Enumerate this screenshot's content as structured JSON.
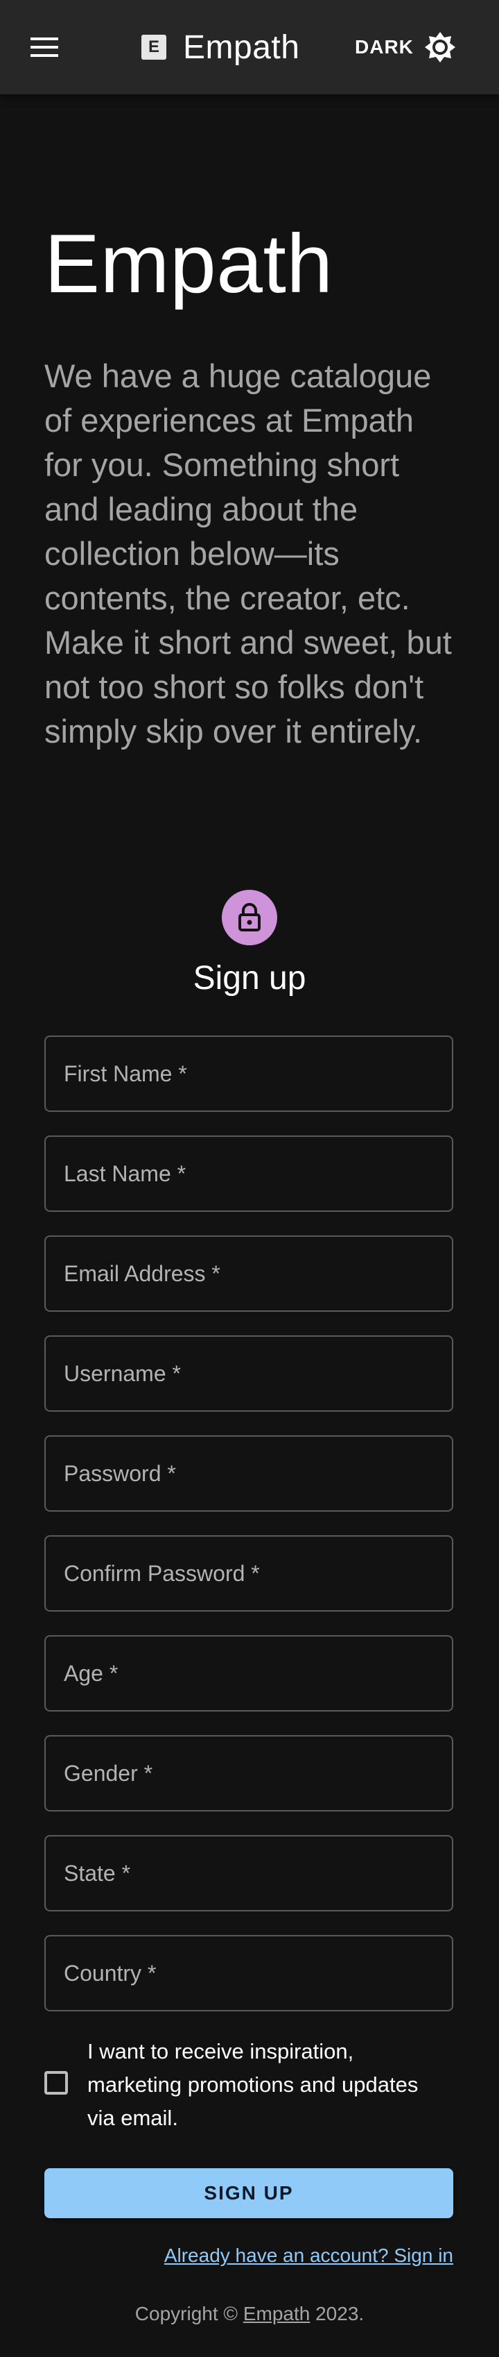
{
  "appbar": {
    "menu_icon": "hamburger-menu-icon",
    "logo_letter": "E",
    "title": "Empath",
    "theme_label": "DARK",
    "theme_icon": "brightness-icon"
  },
  "hero": {
    "title": "Empath",
    "description": "We have a huge catalogue of experiences at Empath for you. Something short and leading about the collection below—its contents, the creator, etc. Make it short and sweet, but not too short so folks don't simply skip over it entirely."
  },
  "signup": {
    "avatar_icon": "lock-icon",
    "title": "Sign up",
    "fields": [
      {
        "label": "First Name *"
      },
      {
        "label": "Last Name *"
      },
      {
        "label": "Email Address *"
      },
      {
        "label": "Username *"
      },
      {
        "label": "Password *"
      },
      {
        "label": "Confirm Password *"
      },
      {
        "label": "Age *"
      },
      {
        "label": "Gender *"
      },
      {
        "label": "State *"
      },
      {
        "label": "Country *"
      }
    ],
    "marketing_checkbox_label": "I want to receive inspiration, marketing promotions and updates via email.",
    "marketing_checked": false,
    "submit_label": "SIGN UP",
    "signin_link": "Already have an account? Sign in"
  },
  "footer": {
    "prefix": "Copyright © ",
    "link": "Empath",
    "suffix": " 2023."
  },
  "colors": {
    "background": "#121212",
    "appbar": "#272727",
    "primary": "#90caf9",
    "avatar": "#ce93d8",
    "secondary_text": "#a5a5a5"
  }
}
